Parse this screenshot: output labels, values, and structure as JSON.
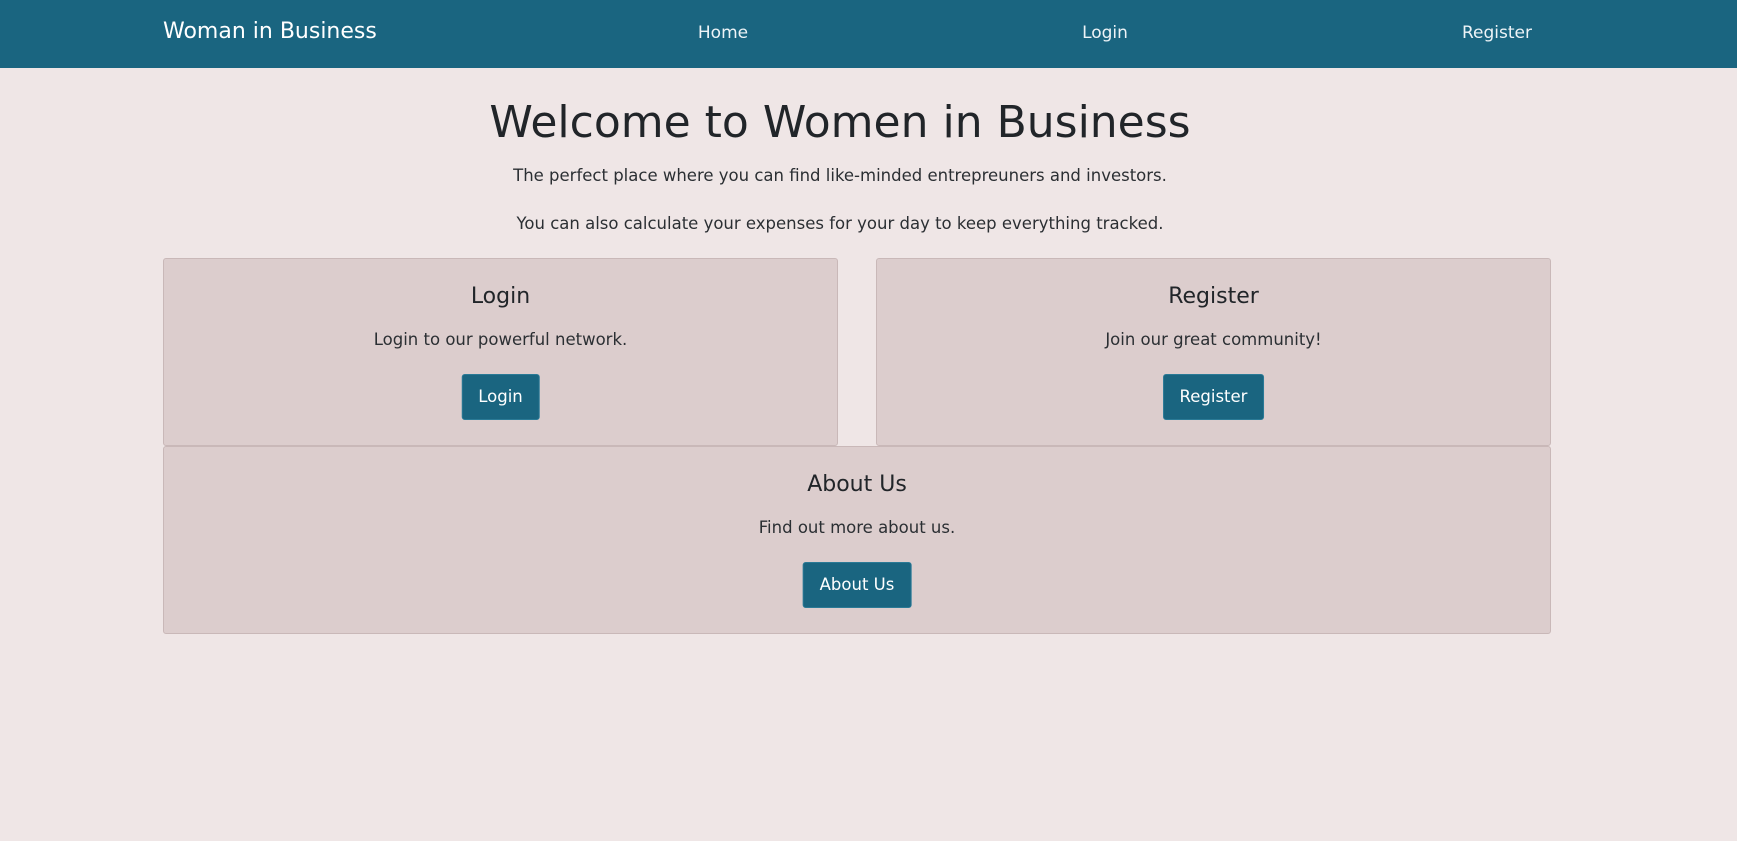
{
  "navbar": {
    "brand": "Woman in Business",
    "links": [
      {
        "label": "Home"
      },
      {
        "label": "Login"
      },
      {
        "label": "Register"
      }
    ]
  },
  "hero": {
    "title": "Welcome to Women in Business",
    "text_1": "The perfect place where you can find like-minded entrepreuners and investors.",
    "text_2": "You can also calculate your expenses for your day to keep everything tracked."
  },
  "cards": {
    "login": {
      "title": "Login",
      "text": "Login to our powerful network.",
      "button": "Login"
    },
    "register": {
      "title": "Register",
      "text": "Join our great community!",
      "button": "Register"
    },
    "about": {
      "title": "About Us",
      "text": "Find out more about us.",
      "button": "About Us"
    }
  },
  "colors": {
    "navbar_bg": "#1a6580",
    "page_bg": "#efe6e6",
    "card_bg": "#dccdcd",
    "button_bg": "#1a6580"
  }
}
